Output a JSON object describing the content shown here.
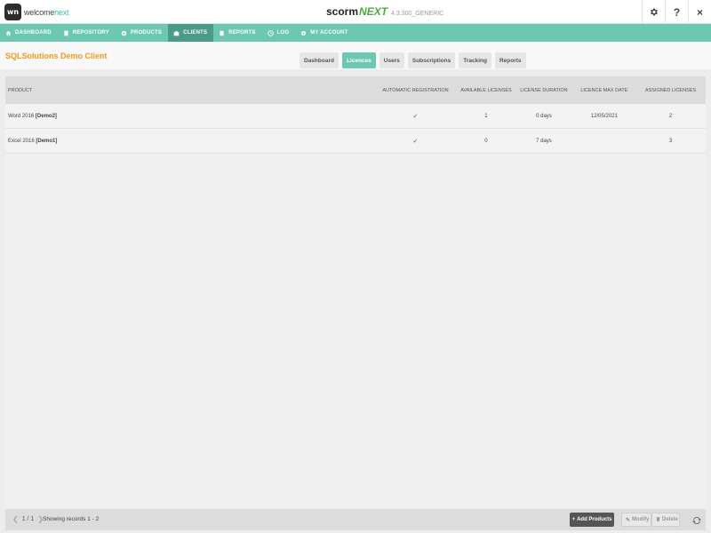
{
  "app": {
    "logo_prefix": "welcome",
    "logo_suffix": "next",
    "logo_badge": "wn",
    "title_a": "scorm",
    "title_b": "NEXT",
    "version": "4.3.300_GENERIC"
  },
  "top_icons": {
    "help": "?",
    "close": "×"
  },
  "nav": {
    "dashboard": "DASHBOARD",
    "repository": "REPOSITORY",
    "products": "PRODUCTS",
    "clients": "CLIENTS",
    "reports": "REPORTS",
    "log": "LOG",
    "account": "MY ACCOUNT"
  },
  "client": {
    "name": "SQLSolutions Demo Client"
  },
  "tabs": {
    "dashboard": "Dashboard",
    "licences": "Licences",
    "users": "Users",
    "subscriptions": "Subscriptions",
    "tracking": "Tracking",
    "reports": "Reports"
  },
  "table": {
    "headers": {
      "product": "PRODUCT",
      "auto": "AUTOMATIC REGISTRATION",
      "available": "AVAILABLE LICENSES",
      "duration": "LICENSE DURATION",
      "max_date": "LICENCE MAX DATE",
      "assigned": "ASSIGNED LICENSES"
    },
    "rows": [
      {
        "product": "Word 2016",
        "code": "[Demo2]",
        "auto": "✓",
        "available": "1",
        "duration": "0 days",
        "max_date": "12/05/2021",
        "assigned": "2"
      },
      {
        "product": "Excel 2016",
        "code": "[Demo1]",
        "auto": "✓",
        "available": "0",
        "duration": "7 days",
        "max_date": "",
        "assigned": "3"
      }
    ]
  },
  "footer": {
    "page": "1 / 1",
    "records": "Showing records 1 - 2",
    "add_label": "Add Products",
    "modify_label": "Modify",
    "delete_label": "Delete"
  },
  "colors": {
    "accent": "#6cc8b0",
    "accent_dark": "#4a9c88",
    "client_name": "#f29a1a"
  },
  "icons": [
    "settings-gear-icon",
    "help-icon",
    "close-icon",
    "refresh-icon"
  ]
}
